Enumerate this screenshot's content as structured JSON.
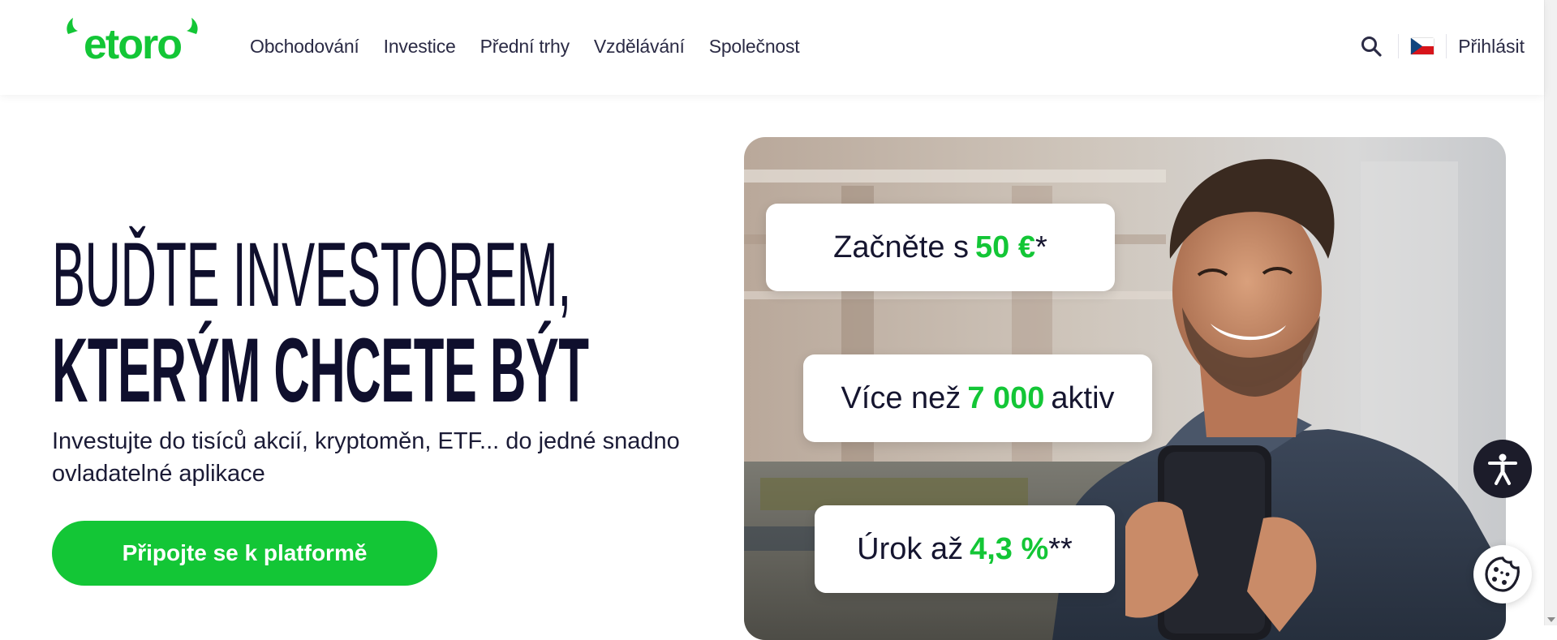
{
  "header": {
    "logo_text": "etoro",
    "nav": [
      "Obchodování",
      "Investice",
      "Přední trhy",
      "Vzdělávání",
      "Společnost"
    ],
    "search_icon": "search-icon",
    "language_flag": "czech-flag-icon",
    "login_label": "Přihlásit"
  },
  "hero": {
    "title_line1": "Buďte investorem,",
    "title_line2": "kterým chcete být",
    "subtitle": "Investujte do tisíců akcií, kryptoměn, ETF... do jedné snadno ovladatelné aplikace",
    "cta_label": "Připojte se k platformě"
  },
  "cards": [
    {
      "prefix": "Začněte s",
      "highlight": "50 €",
      "suffix": "*"
    },
    {
      "prefix": "Více než",
      "highlight": "7 000",
      "suffix": "aktiv"
    },
    {
      "prefix": "Úrok až",
      "highlight": "4,3 %",
      "suffix": "**"
    }
  ],
  "floating": {
    "accessibility_icon": "accessibility-icon",
    "cookie_icon": "cookie-icon"
  },
  "colors": {
    "brand_green": "#13c636",
    "dark_navy": "#0f0f2d",
    "accessibility_bg": "#1c1c2a"
  }
}
